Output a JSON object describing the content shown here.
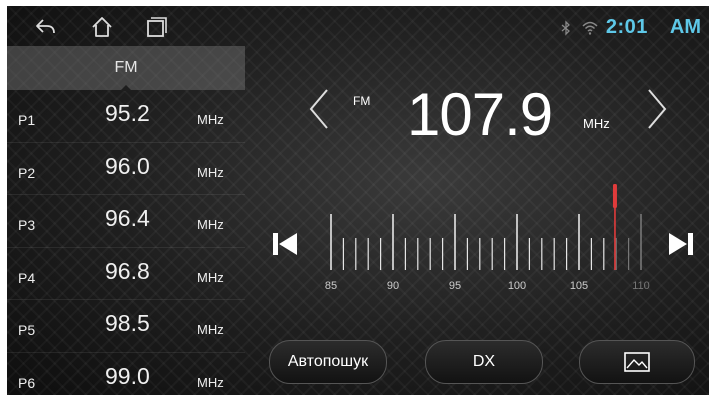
{
  "status": {
    "time": "2:01",
    "ampm": "AM"
  },
  "band_tab": {
    "label": "FM"
  },
  "presets": [
    {
      "label": "P1",
      "freq": "95.2",
      "unit": "MHz"
    },
    {
      "label": "P2",
      "freq": "96.0",
      "unit": "MHz"
    },
    {
      "label": "P3",
      "freq": "96.4",
      "unit": "MHz"
    },
    {
      "label": "P4",
      "freq": "96.8",
      "unit": "MHz"
    },
    {
      "label": "P5",
      "freq": "98.5",
      "unit": "MHz"
    },
    {
      "label": "P6",
      "freq": "99.0",
      "unit": "MHz"
    }
  ],
  "tuner": {
    "band": "FM",
    "frequency": "107.9",
    "unit": "MHz"
  },
  "dial": {
    "min": 85,
    "max": 110,
    "current": 107.9,
    "tick_labels": [
      "85",
      "90",
      "95",
      "100",
      "105",
      "110"
    ],
    "indicator_color": "#e03b3b"
  },
  "buttons": {
    "autosearch": "Автопошук",
    "dx": "DX"
  },
  "icons": {
    "back": "back-icon",
    "home": "home-icon",
    "recents": "recents-icon",
    "bluetooth": "bluetooth-icon",
    "wifi": "wifi-icon",
    "prev_station": "chevron-left-icon",
    "next_station": "chevron-right-icon",
    "seek_back": "skip-previous-icon",
    "seek_forward": "skip-next-icon",
    "picture": "picture-icon"
  },
  "colors": {
    "accent": "#5ec8e8"
  }
}
